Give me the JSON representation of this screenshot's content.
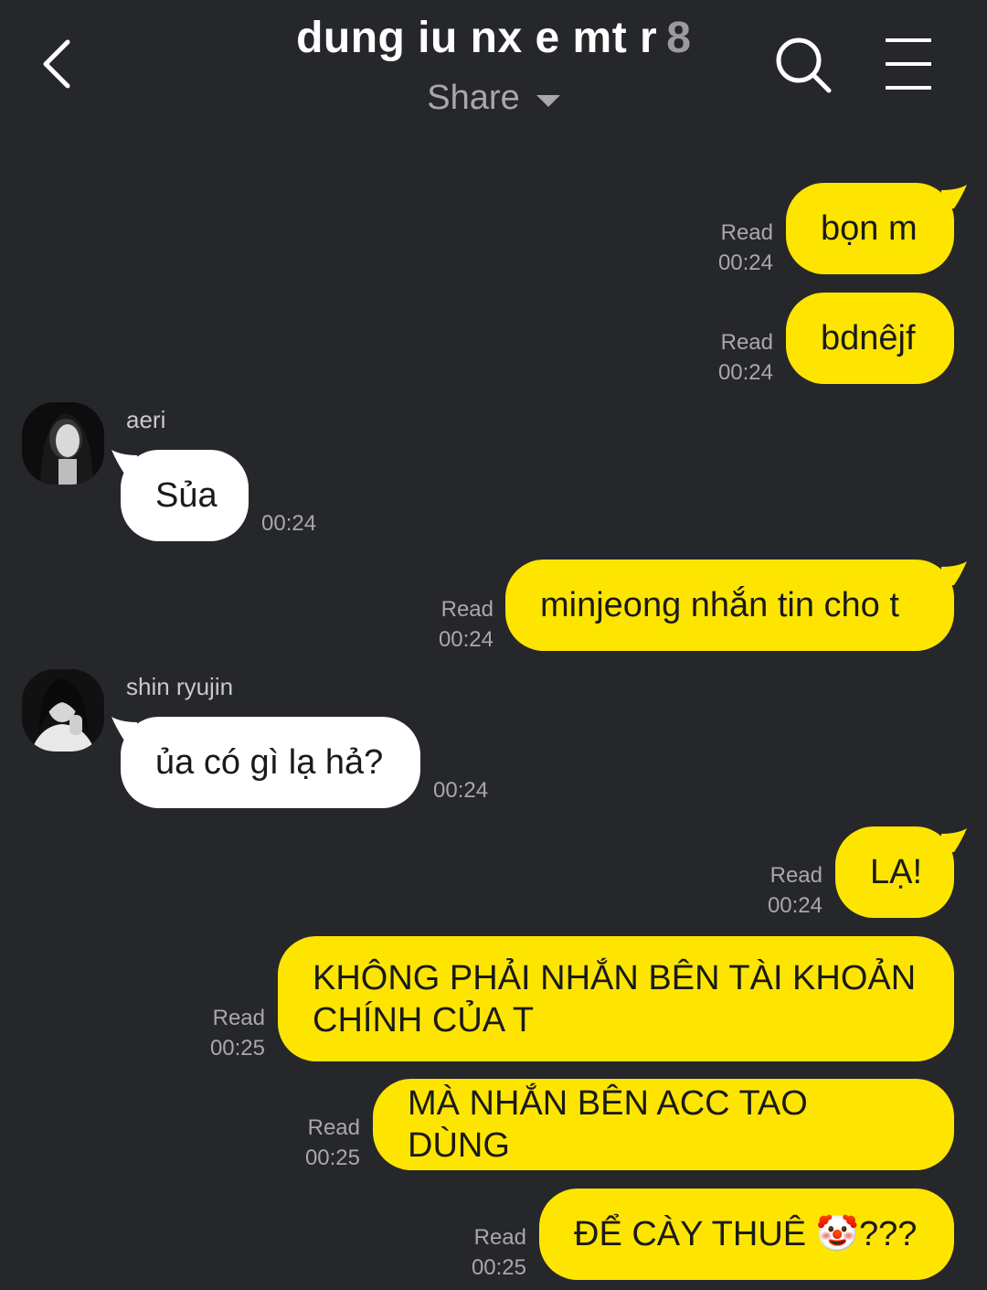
{
  "header": {
    "title": "dung iu nx e mt r",
    "member_count": "8",
    "share_label": "Share",
    "back_icon": "chevron-left-icon",
    "search_icon": "search-icon",
    "menu_icon": "menu-icon"
  },
  "colors": {
    "background": "#26272b",
    "outgoing_bubble": "#fee500",
    "incoming_bubble": "#ffffff",
    "meta_text": "#a8a8ab"
  },
  "messages": [
    {
      "direction": "out",
      "text": "bọn m",
      "status": "Read",
      "time": "00:24"
    },
    {
      "direction": "out",
      "text": "bdnêjf",
      "status": "Read",
      "time": "00:24"
    },
    {
      "direction": "in",
      "sender": "aeri",
      "text": "Sủa",
      "time": "00:24"
    },
    {
      "direction": "out",
      "text": "minjeong nhắn tin cho t",
      "status": "Read",
      "time": "00:24"
    },
    {
      "direction": "in",
      "sender": "shin ryujin",
      "text": "ủa có gì lạ hả?",
      "time": "00:24"
    },
    {
      "direction": "out",
      "text": "LẠ!",
      "status": "Read",
      "time": "00:24"
    },
    {
      "direction": "out",
      "text": "KHÔNG PHẢI NHẮN BÊN TÀI KHOẢN CHÍNH CỦA T",
      "status": "Read",
      "time": "00:25"
    },
    {
      "direction": "out",
      "text": "MÀ NHẮN BÊN ACC TAO DÙNG",
      "status": "Read",
      "time": "00:25"
    },
    {
      "direction": "out",
      "text": "ĐỂ CÀY THUÊ 🤡???",
      "status": "Read",
      "time": "00:25"
    }
  ]
}
